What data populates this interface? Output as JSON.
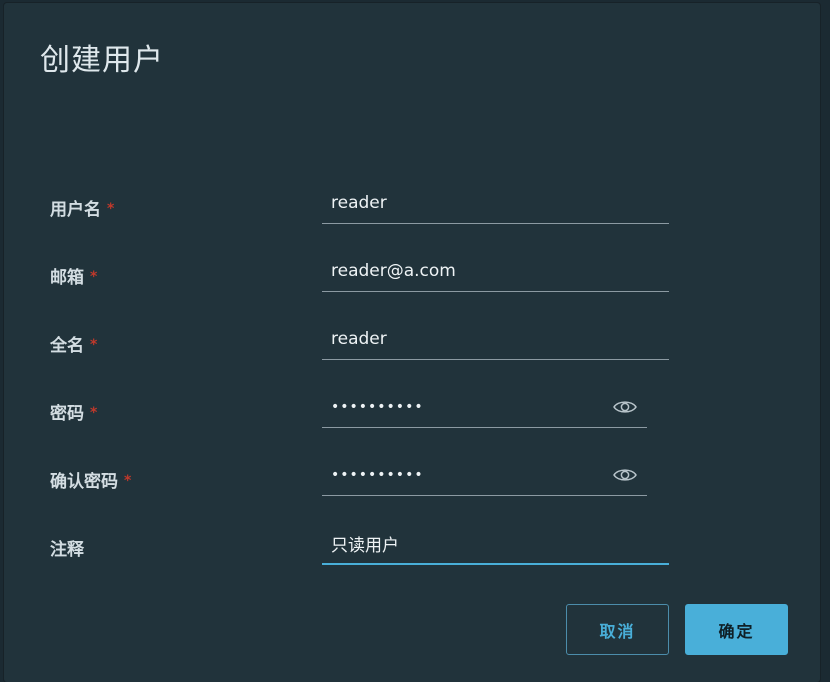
{
  "dialog": {
    "title": "创建用户"
  },
  "form": {
    "fields": [
      {
        "label": "用户名",
        "required": true,
        "value": "reader",
        "type": "text"
      },
      {
        "label": "邮箱",
        "required": true,
        "value": "reader@a.com",
        "type": "text"
      },
      {
        "label": "全名",
        "required": true,
        "value": "reader",
        "type": "text"
      },
      {
        "label": "密码",
        "required": true,
        "value": "••••••••••",
        "type": "password",
        "icon": "eye-icon"
      },
      {
        "label": "确认密码",
        "required": true,
        "value": "••••••••••",
        "type": "password",
        "icon": "eye-icon"
      },
      {
        "label": "注释",
        "required": false,
        "value": "只读用户",
        "type": "text",
        "focused": true
      }
    ],
    "required_marker": "*"
  },
  "buttons": {
    "cancel_label": "取消",
    "ok_label": "确定"
  },
  "colors": {
    "background": "#21333b",
    "accent": "#49afd9",
    "required": "#c0392b",
    "text": "#eef3f5"
  }
}
